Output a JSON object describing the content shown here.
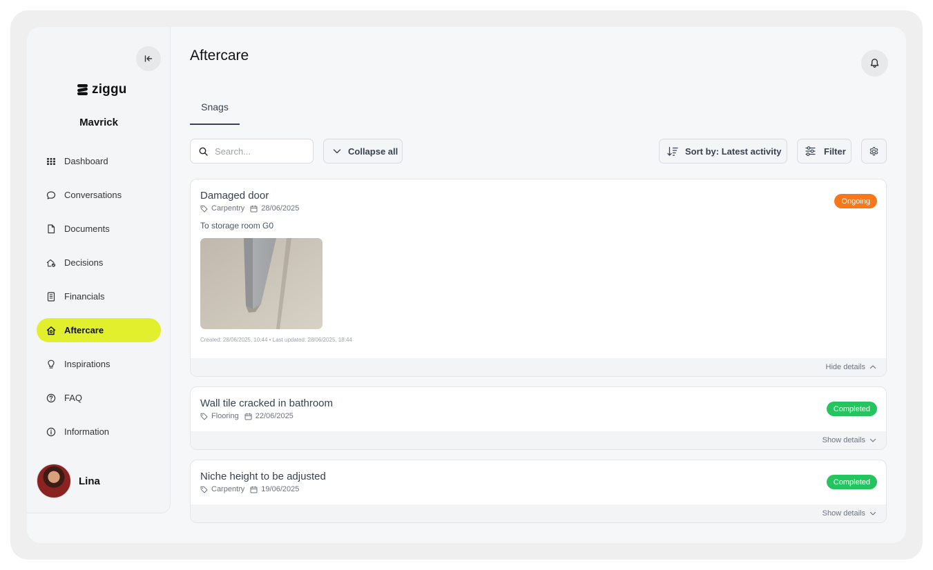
{
  "sidebar": {
    "logo_text": "ziggu",
    "project_name": "Mavrick",
    "items": [
      {
        "label": "Dashboard",
        "icon": "grid-icon"
      },
      {
        "label": "Conversations",
        "icon": "chat-bubble-icon"
      },
      {
        "label": "Documents",
        "icon": "document-icon"
      },
      {
        "label": "Decisions",
        "icon": "house-check-icon"
      },
      {
        "label": "Financials",
        "icon": "receipt-icon"
      },
      {
        "label": "Aftercare",
        "icon": "house-icon",
        "active": true
      },
      {
        "label": "Inspirations",
        "icon": "lightbulb-icon"
      },
      {
        "label": "FAQ",
        "icon": "question-circle-icon"
      },
      {
        "label": "Information",
        "icon": "info-circle-icon"
      }
    ],
    "user_name": "Lina"
  },
  "header": {
    "title": "Aftercare"
  },
  "tabs": [
    {
      "label": "Snags",
      "active": true
    }
  ],
  "toolbar": {
    "search_placeholder": "Search...",
    "collapse_label": "Collapse all",
    "sort_label": "Sort by: Latest activity",
    "filter_label": "Filter"
  },
  "snags": [
    {
      "title": "Damaged door",
      "category": "Carpentry",
      "date": "28/06/2025",
      "status": "Ongoing",
      "description": "To storage room G0",
      "stamps": "Created: 28/06/2025, 10:44 • Last updated: 28/06/2025, 18:44",
      "toggle": "Hide details"
    },
    {
      "title": "Wall tile cracked in bathroom",
      "category": "Flooring",
      "date": "22/06/2025",
      "status": "Completed",
      "toggle": "Show details"
    },
    {
      "title": "Niche height to be adjusted",
      "category": "Carpentry",
      "date": "19/06/2025",
      "status": "Completed",
      "toggle": "Show details"
    }
  ],
  "colors": {
    "accent": "#e2ef2c",
    "ongoing": "#f7781a",
    "completed": "#22c55e"
  }
}
